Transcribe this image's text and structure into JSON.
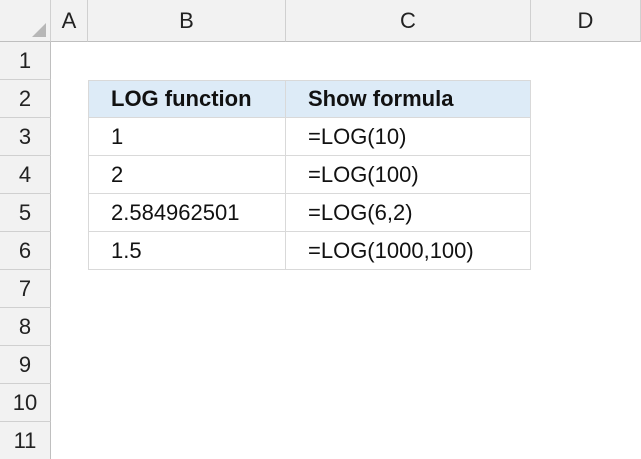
{
  "columns": [
    "A",
    "B",
    "C",
    "D"
  ],
  "rows": [
    "1",
    "2",
    "3",
    "4",
    "5",
    "6",
    "7",
    "8",
    "9",
    "10",
    "11"
  ],
  "table": {
    "headers": [
      "LOG function",
      "Show formula"
    ],
    "rows": [
      [
        "1",
        "=LOG(10)"
      ],
      [
        "2",
        "=LOG(100)"
      ],
      [
        "2.584962501",
        "=LOG(6,2)"
      ],
      [
        "1.5",
        "=LOG(1000,100)"
      ]
    ]
  },
  "colors": {
    "header_fill": "#ddebf7",
    "sheet_header_bg": "#f2f2f2",
    "gridline": "#d9d9d9"
  }
}
